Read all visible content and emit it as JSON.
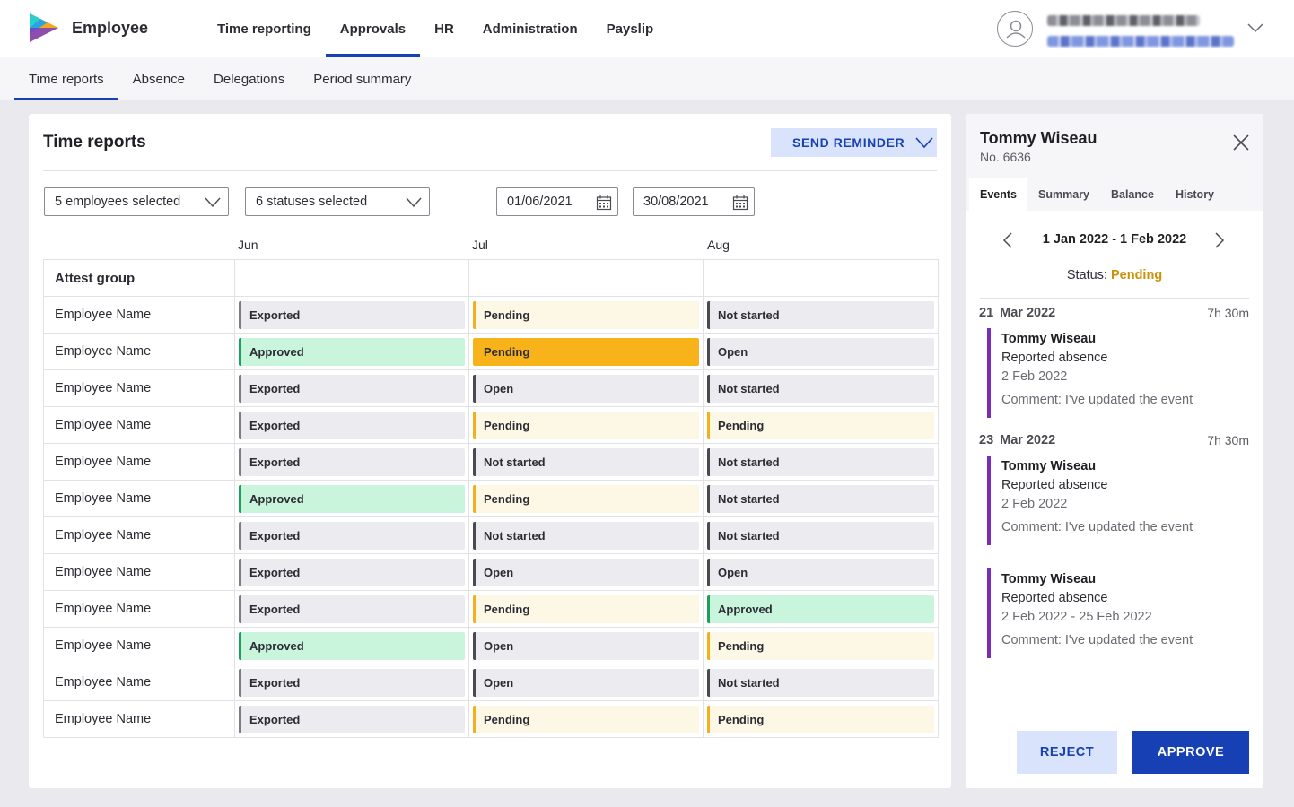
{
  "app": {
    "name": "Employee",
    "logo_icon": "play-logo-icon"
  },
  "main_nav": [
    {
      "label": "Time reporting",
      "active": false
    },
    {
      "label": "Approvals",
      "active": true
    },
    {
      "label": "HR",
      "active": false
    },
    {
      "label": "Administration",
      "active": false
    },
    {
      "label": "Payslip",
      "active": false
    }
  ],
  "user": {
    "avatar_icon": "user-avatar-icon",
    "menu_icon": "chevron-down-icon"
  },
  "sub_nav": [
    {
      "label": "Time reports",
      "active": true
    },
    {
      "label": "Absence",
      "active": false
    },
    {
      "label": "Delegations",
      "active": false
    },
    {
      "label": "Period summary",
      "active": false
    }
  ],
  "time_reports": {
    "title": "Time reports",
    "send_reminder_label": "SEND REMINDER",
    "employees_filter": "5 employees selected",
    "statuses_filter": "6 statuses selected",
    "date_from": "01/06/2021",
    "date_to": "30/08/2021",
    "months": [
      "Jun",
      "Jul",
      "Aug"
    ],
    "group_header": "Attest group",
    "rows": [
      {
        "name": "Employee Name",
        "statuses": [
          "Exported",
          "Pending",
          "Not started"
        ]
      },
      {
        "name": "Employee Name",
        "statuses": [
          "Approved",
          "Pending",
          "Open"
        ]
      },
      {
        "name": "Employee Name",
        "statuses": [
          "Exported",
          "Open",
          "Not started"
        ]
      },
      {
        "name": "Employee Name",
        "statuses": [
          "Exported",
          "Pending",
          "Pending"
        ]
      },
      {
        "name": "Employee Name",
        "statuses": [
          "Exported",
          "Not started",
          "Not started"
        ]
      },
      {
        "name": "Employee Name",
        "statuses": [
          "Approved",
          "Pending",
          "Not started"
        ]
      },
      {
        "name": "Employee Name",
        "statuses": [
          "Exported",
          "Not started",
          "Not started"
        ]
      },
      {
        "name": "Employee Name",
        "statuses": [
          "Exported",
          "Open",
          "Open"
        ]
      },
      {
        "name": "Employee Name",
        "statuses": [
          "Exported",
          "Pending",
          "Approved"
        ]
      },
      {
        "name": "Employee Name",
        "statuses": [
          "Approved",
          "Open",
          "Pending"
        ]
      },
      {
        "name": "Employee Name",
        "statuses": [
          "Exported",
          "Open",
          "Not started"
        ]
      },
      {
        "name": "Employee Name",
        "statuses": [
          "Exported",
          "Pending",
          "Pending"
        ]
      }
    ],
    "selected_cell": {
      "row": 1,
      "col": 1
    },
    "status_colors": {
      "Exported": {
        "bg": "#ebebf0",
        "border": "#7c7c86"
      },
      "Approved": {
        "bg": "#c8f5dc",
        "border": "#1e9e5c"
      },
      "Pending": {
        "bg": "#fdf7e6",
        "border": "#f2b01e"
      },
      "Open": {
        "bg": "#ebebf0",
        "border": "#4a4a54"
      },
      "Not started": {
        "bg": "#ebebf0",
        "border": "#4a4a54"
      },
      "selected": {
        "bg": "#f8b21a",
        "border": "#f8b21a"
      }
    }
  },
  "panel": {
    "name": "Tommy Wiseau",
    "number": "No. 6636",
    "tabs": [
      {
        "label": "Events",
        "active": true
      },
      {
        "label": "Summary",
        "active": false
      },
      {
        "label": "Balance",
        "active": false
      },
      {
        "label": "History",
        "active": false
      }
    ],
    "range": "1 Jan 2022 - 1 Feb 2022",
    "status_label": "Status:",
    "status_value": "Pending",
    "groups": [
      {
        "day": "21",
        "month": "Mar 2022",
        "duration": "7h 30m"
      },
      {
        "day": "23",
        "month": "Mar 2022",
        "duration": "7h 30m"
      }
    ],
    "events": [
      {
        "name": "Tommy Wiseau",
        "type": "Reported absence",
        "when": "2 Feb 2022",
        "comment": "Comment: I've updated the event"
      },
      {
        "name": "Tommy Wiseau",
        "type": "Reported absence",
        "when": "2 Feb 2022",
        "comment": "Comment: I've updated the event"
      },
      {
        "name": "Tommy Wiseau",
        "type": "Reported absence",
        "when": "2 Feb 2022 - 25 Feb 2022",
        "comment": "Comment: I've updated the event"
      }
    ],
    "reject_label": "REJECT",
    "approve_label": "APPROVE",
    "accent_color": "#7a2cb4"
  },
  "colors": {
    "brand": "#1640b3",
    "brand_light": "#d9e3fb",
    "pending_text": "#c99208"
  }
}
